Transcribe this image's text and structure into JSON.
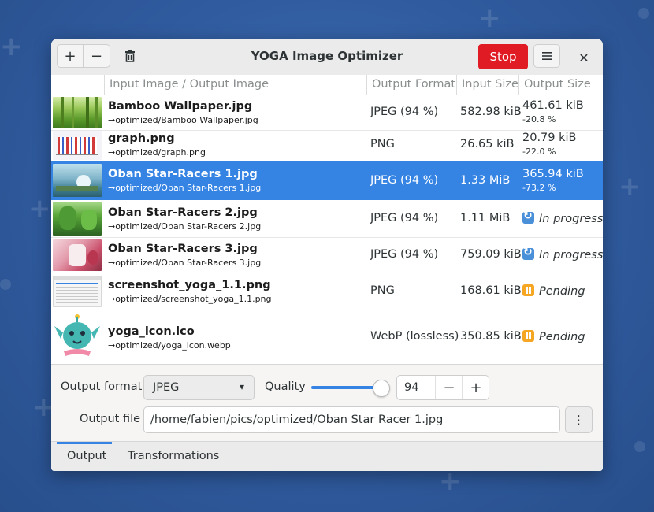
{
  "window": {
    "title": "YOGA Image Optimizer"
  },
  "headerbar": {
    "add_icon": "plus-icon",
    "remove_icon": "minus-icon",
    "clear_icon": "trash-icon",
    "stop_label": "Stop",
    "menu_icon": "hamburger-menu-icon",
    "close_icon": "close-icon",
    "stop_color": "#e01b24"
  },
  "columns": [
    "Input Image / Output Image",
    "Output Format",
    "Input Size",
    "Output Size"
  ],
  "rows": [
    {
      "name": "Bamboo Wallpaper.jpg",
      "output": "→optimized/Bamboo Wallpaper.jpg",
      "format": "JPEG (94 %)",
      "input_size": "582.98 kiB",
      "output_size": "461.61 kiB",
      "ratio": "-20.8 %"
    },
    {
      "name": "graph.png",
      "output": "→optimized/graph.png",
      "format": "PNG",
      "input_size": "26.65 kiB",
      "output_size": "20.79 kiB",
      "ratio": "-22.0 %"
    },
    {
      "name": "Oban Star-Racers 1.jpg",
      "output": "→optimized/Oban Star-Racers 1.jpg",
      "format": "JPEG (94 %)",
      "input_size": "1.33 MiB",
      "output_size": "365.94 kiB",
      "ratio": "-73.2 %"
    },
    {
      "name": "Oban Star-Racers 2.jpg",
      "output": "→optimized/Oban Star-Racers 2.jpg",
      "format": "JPEG (94 %)",
      "input_size": "1.11 MiB",
      "status": "In progress"
    },
    {
      "name": "Oban Star-Racers 3.jpg",
      "output": "→optimized/Oban Star-Racers 3.jpg",
      "format": "JPEG (94 %)",
      "input_size": "759.09 kiB",
      "status": "In progress"
    },
    {
      "name": "screenshot_yoga_1.1.png",
      "output": "→optimized/screenshot_yoga_1.1.png",
      "format": "PNG",
      "input_size": "168.61 kiB",
      "status": "Pending"
    },
    {
      "name": "yoga_icon.ico",
      "output": "→optimized/yoga_icon.webp",
      "format": "WebP (lossless)",
      "input_size": "350.85 kiB",
      "status": "Pending"
    }
  ],
  "settings": {
    "output_format_label": "Output format",
    "output_format_value": "JPEG",
    "quality_label": "Quality",
    "quality_value": "94",
    "quality_level": 0.94,
    "output_file_label": "Output file",
    "output_file_value": "/home/fabien/pics/optimized/Oban Star Racer 1.jpg"
  },
  "tabs": {
    "output": "Output",
    "transformations": "Transformations",
    "active": "Output"
  },
  "colors": {
    "accent": "#3584e4",
    "in_progress": "#4a90d9",
    "pending": "#f5a623"
  }
}
